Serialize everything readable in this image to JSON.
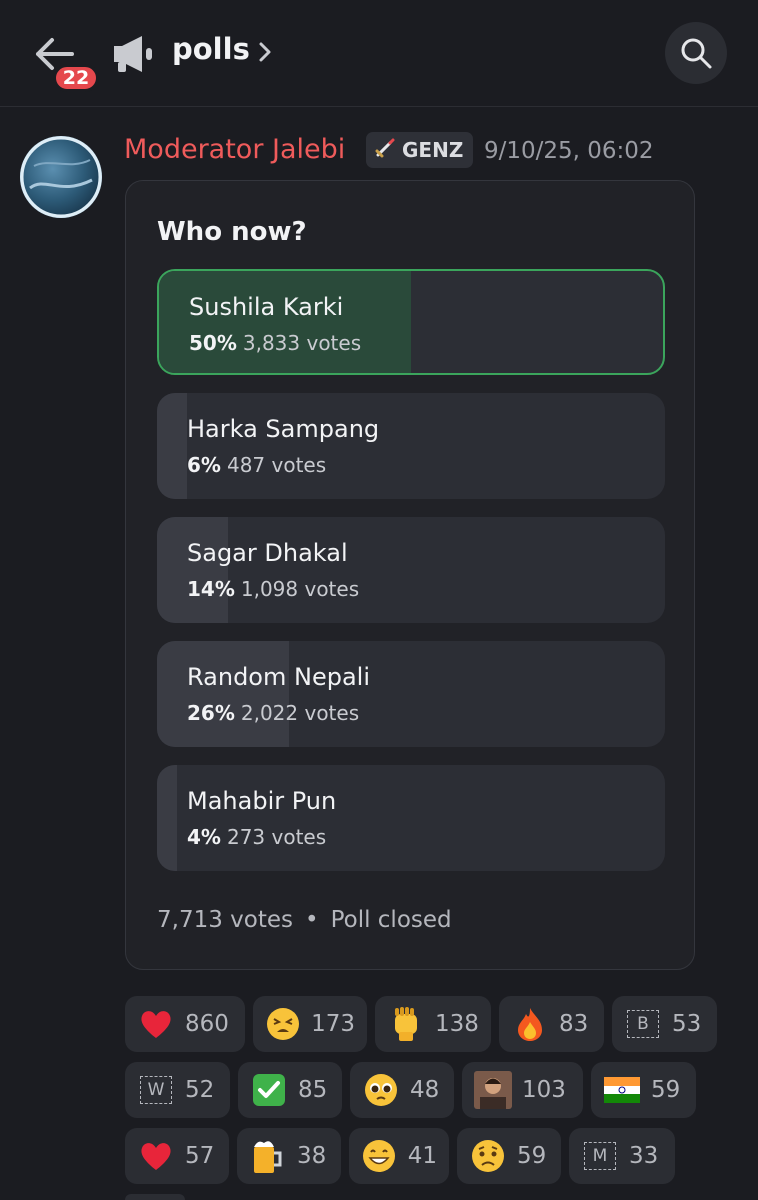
{
  "header": {
    "notification_count": "22",
    "channel_name": "polls",
    "chevron": ">"
  },
  "message": {
    "author": "Moderator Jalebi",
    "tag": "GENZ",
    "timestamp": "9/10/25, 06:02"
  },
  "poll": {
    "question": "Who now?",
    "options": [
      {
        "name": "Sushila Karki",
        "percent": "50%",
        "votes": "3,833 votes",
        "fraction": 0.5,
        "winner": true
      },
      {
        "name": "Harka Sampang",
        "percent": "6%",
        "votes": "487 votes",
        "fraction": 0.06
      },
      {
        "name": "Sagar Dhakal",
        "percent": "14%",
        "votes": "1,098 votes",
        "fraction": 0.14
      },
      {
        "name": "Random Nepali",
        "percent": "26%",
        "votes": "2,022 votes",
        "fraction": 0.26
      },
      {
        "name": "Mahabir Pun",
        "percent": "4%",
        "votes": "273 votes",
        "fraction": 0.04
      }
    ],
    "total_votes": "7,713 votes",
    "separator": "•",
    "status": "Poll closed"
  },
  "reactions": [
    {
      "icon": "red-heart",
      "count": "860"
    },
    {
      "icon": "tired-face",
      "count": "173"
    },
    {
      "icon": "raised-fist",
      "count": "138"
    },
    {
      "icon": "fire",
      "count": "83"
    },
    {
      "icon": "custom-b",
      "label": "B",
      "count": "53"
    },
    {
      "icon": "custom-w",
      "label": "W",
      "count": "52"
    },
    {
      "icon": "check-mark",
      "count": "85"
    },
    {
      "icon": "pleading-face",
      "count": "48"
    },
    {
      "icon": "custom-photo",
      "count": "103"
    },
    {
      "icon": "india-flag",
      "count": "59"
    },
    {
      "icon": "red-heart",
      "count": "57"
    },
    {
      "icon": "beer-mug",
      "count": "38"
    },
    {
      "icon": "grinning-face",
      "count": "41"
    },
    {
      "icon": "worried-face",
      "count": "59"
    },
    {
      "icon": "custom-m",
      "label": "M",
      "count": "33"
    }
  ],
  "colors": {
    "author": "#ef5b5b",
    "winner_border": "#3ba55c",
    "badge": "#e5484d"
  }
}
